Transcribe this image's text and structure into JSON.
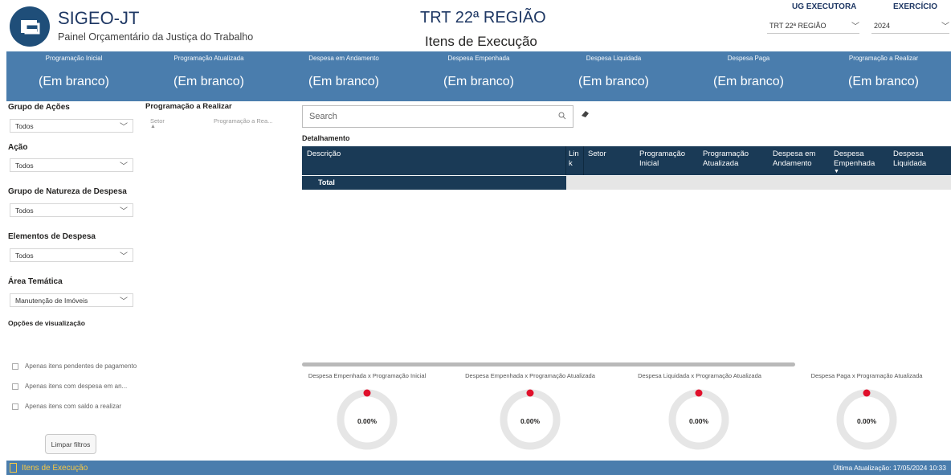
{
  "header": {
    "app_title": "SIGEO-JT",
    "app_subtitle": "Painel Orçamentário da Justiça do Trabalho",
    "region_title": "TRT 22ª REGIÃO",
    "page_subtitle": "Itens de Execução",
    "ug_label": "UG EXECUTORA",
    "ug_value": "TRT 22ª REGIÃO",
    "exercicio_label": "EXERCÍCIO",
    "exercicio_value": "2024"
  },
  "kpis": [
    {
      "label": "Programação Inicial",
      "value": "(Em branco)"
    },
    {
      "label": "Programação Atualizada",
      "value": "(Em branco)"
    },
    {
      "label": "Despesa em Andamento",
      "value": "(Em branco)"
    },
    {
      "label": "Despesa Empenhada",
      "value": "(Em branco)"
    },
    {
      "label": "Despesa Liquidada",
      "value": "(Em branco)"
    },
    {
      "label": "Despesa Paga",
      "value": "(Em branco)"
    },
    {
      "label": "Programação a Realizar",
      "value": "(Em branco)"
    }
  ],
  "filters": {
    "grupo_acoes": {
      "label": "Grupo de Ações",
      "value": "Todos"
    },
    "acao": {
      "label": "Ação",
      "value": "Todos"
    },
    "grupo_natureza": {
      "label": "Grupo de Natureza de Despesa",
      "value": "Todos"
    },
    "elementos": {
      "label": "Elementos de Despesa",
      "value": "Todos"
    },
    "area_tematica": {
      "label": "Área Temática",
      "value": "Manutenção de Imóveis"
    },
    "opcoes_label": "Opções de visualização",
    "checkboxes": [
      "Apenas itens pendentes de pagamento",
      "Apenas itens com despesa em an...",
      "Apenas itens com saldo a realizar"
    ],
    "clear_label": "Limpar filtros"
  },
  "prog_realizar": {
    "title": "Programação a Realizar",
    "col1": "Setor",
    "col2": "Programação a Rea..."
  },
  "search": {
    "placeholder": "Search"
  },
  "detalhamento": {
    "title": "Detalhamento",
    "columns": [
      "Descrição",
      "Lin k",
      "Setor",
      "Programação Inicial",
      "Programação Atualizada",
      "Despesa em Andamento",
      "Despesa Empenhada",
      "Despesa Liquidada"
    ],
    "total_label": "Total"
  },
  "gauges": [
    {
      "title": "Despesa Empenhada x Programação Inicial",
      "value": "0.00%"
    },
    {
      "title": "Despesa Empenhada x Programação Atualizada",
      "value": "0.00%"
    },
    {
      "title": "Despesa Liquidada x Programação Atualizada",
      "value": "0.00%"
    },
    {
      "title": "Despesa Paga x Programação Atualizada",
      "value": "0.00%"
    }
  ],
  "footer": {
    "page_tab": "Itens de Execução",
    "last_update": "Última Atualização: 17/05/2024 10:33"
  },
  "colors": {
    "band": "#4a7dad",
    "table_header": "#1a3a56",
    "gauge_track": "#e6e6e6",
    "gauge_marker": "#e0102b",
    "footer_accent": "#f7c843"
  }
}
